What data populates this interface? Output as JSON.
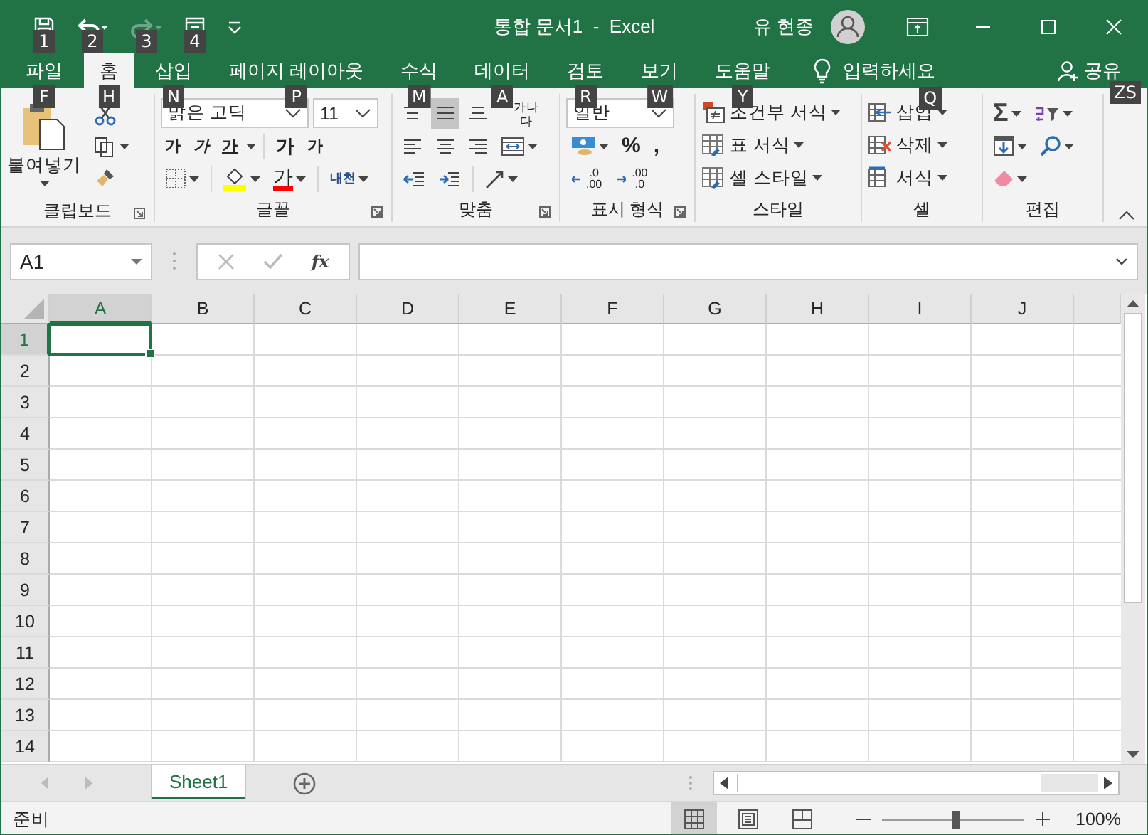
{
  "window": {
    "title": "통합 문서1  -  Excel",
    "user": "유 현종"
  },
  "quick_access": [
    {
      "kind": "save",
      "keytip": "1",
      "disabled": false
    },
    {
      "kind": "undo",
      "keytip": "2",
      "disabled": false
    },
    {
      "kind": "redo",
      "keytip": "3",
      "disabled": true
    },
    {
      "kind": "form",
      "keytip": "4",
      "disabled": false
    }
  ],
  "tabs": [
    {
      "label": "파일",
      "keytip": "F",
      "selected": false
    },
    {
      "label": "홈",
      "keytip": "H",
      "selected": true
    },
    {
      "label": "삽입",
      "keytip": "N",
      "selected": false
    },
    {
      "label": "페이지 레이아웃",
      "keytip": "P",
      "selected": false
    },
    {
      "label": "수식",
      "keytip": "M",
      "selected": false
    },
    {
      "label": "데이터",
      "keytip": "A",
      "selected": false
    },
    {
      "label": "검토",
      "keytip": "R",
      "selected": false
    },
    {
      "label": "보기",
      "keytip": "W",
      "selected": false
    },
    {
      "label": "도움말",
      "keytip": "Y",
      "selected": false
    }
  ],
  "tell_me": {
    "label": "입력하세요",
    "keytip": "Q"
  },
  "share": {
    "label": "공유",
    "keytip": "ZS"
  },
  "ribbon": {
    "clipboard": {
      "label": "클립보드",
      "paste": "붙여넣기"
    },
    "font": {
      "label": "글꼴",
      "font_name": "맑은 고딕",
      "font_size": "11",
      "styles": [
        {
          "kind": "bold",
          "text": "가"
        },
        {
          "kind": "italic",
          "text": "가"
        },
        {
          "kind": "underline",
          "text": "가"
        }
      ],
      "sizes": [
        {
          "kind": "grow",
          "text": "가"
        },
        {
          "kind": "shrink",
          "text": "가"
        }
      ],
      "font_color_text": "가",
      "phonetic_text": "내천"
    },
    "alignment": {
      "label": "맞춤",
      "vertical": [
        {
          "kind": "top",
          "selected": false
        },
        {
          "kind": "middle",
          "selected": true
        },
        {
          "kind": "bottom",
          "selected": false
        }
      ],
      "wrap_text": "가나다"
    },
    "number": {
      "label": "표시 형식",
      "format": "일반",
      "percent": "%",
      "comma": ",",
      "decimals": [
        {
          "kind": "increase",
          "lines": [
            ".0",
            ".00"
          ]
        },
        {
          "kind": "decrease",
          "lines": [
            ".00",
            ".0"
          ]
        }
      ]
    },
    "styles": {
      "label": "스타일",
      "items": [
        {
          "kind": "conditional",
          "label": "조건부 서식"
        },
        {
          "kind": "table",
          "label": "표 서식"
        },
        {
          "kind": "cell",
          "label": "셀 스타일"
        }
      ]
    },
    "cells": {
      "label": "셀",
      "items": [
        {
          "kind": "insert",
          "label": "삽입"
        },
        {
          "kind": "delete",
          "label": "삭제"
        },
        {
          "kind": "format",
          "label": "서식"
        }
      ]
    },
    "editing": {
      "label": "편집",
      "sum": "Σ"
    }
  },
  "formula_bar": {
    "name_box": "A1",
    "fx": "fx"
  },
  "sheet": {
    "columns": [
      {
        "label": "A",
        "selected": true
      },
      {
        "label": "B",
        "selected": false
      },
      {
        "label": "C",
        "selected": false
      },
      {
        "label": "D",
        "selected": false
      },
      {
        "label": "E",
        "selected": false
      },
      {
        "label": "F",
        "selected": false
      },
      {
        "label": "G",
        "selected": false
      },
      {
        "label": "H",
        "selected": false
      },
      {
        "label": "I",
        "selected": false
      },
      {
        "label": "J",
        "selected": false
      }
    ],
    "rows": [
      {
        "label": "1",
        "selected": true
      },
      {
        "label": "2",
        "selected": false
      },
      {
        "label": "3",
        "selected": false
      },
      {
        "label": "4",
        "selected": false
      },
      {
        "label": "5",
        "selected": false
      },
      {
        "label": "6",
        "selected": false
      },
      {
        "label": "7",
        "selected": false
      },
      {
        "label": "8",
        "selected": false
      },
      {
        "label": "9",
        "selected": false
      },
      {
        "label": "10",
        "selected": false
      },
      {
        "label": "11",
        "selected": false
      },
      {
        "label": "12",
        "selected": false
      },
      {
        "label": "13",
        "selected": false
      },
      {
        "label": "14",
        "selected": false
      }
    ]
  },
  "sheet_tabs": [
    {
      "label": "Sheet1",
      "selected": true
    }
  ],
  "status_bar": {
    "status": "준비",
    "views": [
      {
        "kind": "normal",
        "selected": true
      },
      {
        "kind": "page_layout",
        "selected": false
      },
      {
        "kind": "page_break",
        "selected": false
      }
    ],
    "zoom": {
      "level": 0.5,
      "reading": "100%"
    }
  }
}
